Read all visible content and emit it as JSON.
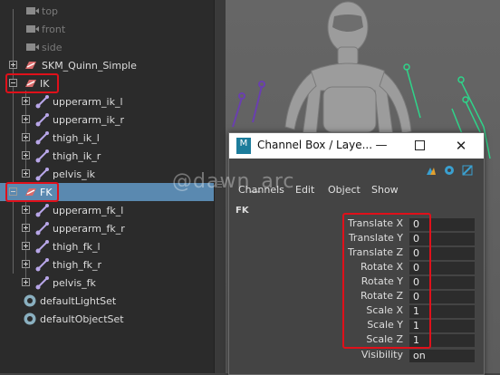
{
  "outliner": {
    "items": [
      {
        "label": "top"
      },
      {
        "label": "front"
      },
      {
        "label": "side"
      },
      {
        "label": "SKM_Quinn_Simple"
      },
      {
        "label": "IK"
      },
      {
        "label": "upperarm_ik_l"
      },
      {
        "label": "upperarm_ik_r"
      },
      {
        "label": "thigh_ik_l"
      },
      {
        "label": "thigh_ik_r"
      },
      {
        "label": "pelvis_ik"
      },
      {
        "label": "FK"
      },
      {
        "label": "upperarm_fk_l"
      },
      {
        "label": "upperarm_fk_r"
      },
      {
        "label": "thigh_fk_l"
      },
      {
        "label": "thigh_fk_r"
      },
      {
        "label": "pelvis_fk"
      },
      {
        "label": "defaultLightSet"
      },
      {
        "label": "defaultObjectSet"
      }
    ]
  },
  "channel_box": {
    "title": "Channel Box / Laye...",
    "logo": "M",
    "menus": [
      "Channels",
      "Edit",
      "Object",
      "Show"
    ],
    "node": "FK",
    "channels": [
      {
        "name": "Translate X",
        "value": "0"
      },
      {
        "name": "Translate Y",
        "value": "0"
      },
      {
        "name": "Translate Z",
        "value": "0"
      },
      {
        "name": "Rotate X",
        "value": "0"
      },
      {
        "name": "Rotate Y",
        "value": "0"
      },
      {
        "name": "Rotate Z",
        "value": "0"
      },
      {
        "name": "Scale X",
        "value": "1"
      },
      {
        "name": "Scale Y",
        "value": "1"
      },
      {
        "name": "Scale Z",
        "value": "1"
      },
      {
        "name": "Visibility",
        "value": "on"
      }
    ]
  },
  "watermark": "@dawn_arc",
  "colors": {
    "selection": "#5a89b0",
    "highlight_box": "#e0101a",
    "ik_joint": "#6a3fb0",
    "fk_joint": "#2fd48a"
  }
}
